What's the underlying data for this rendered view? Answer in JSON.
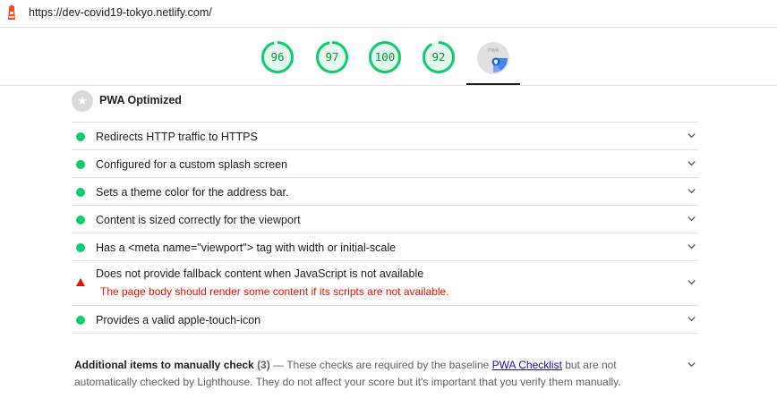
{
  "topbar": {
    "url": "https://dev-covid19-tokyo.netlify.com/",
    "logo_icon": "lighthouse-icon"
  },
  "gauges": [
    {
      "label": "96",
      "value": 96
    },
    {
      "label": "97",
      "value": 97
    },
    {
      "label": "100",
      "value": 100
    },
    {
      "label": "92",
      "value": 92
    }
  ],
  "pwa_gauge": {
    "label": "PWA",
    "icon": "pwa-badge-icon"
  },
  "colors": {
    "pass": "#0cce6b",
    "fail": "#eb0f00",
    "link": "#1a0dab"
  },
  "category": {
    "title": "PWA Optimized",
    "icon": "star-icon"
  },
  "audits": [
    {
      "title": "Redirects HTTP traffic to HTTPS",
      "status": "pass"
    },
    {
      "title": "Configured for a custom splash screen",
      "status": "pass"
    },
    {
      "title": "Sets a theme color for the address bar.",
      "status": "pass"
    },
    {
      "title": "Content is sized correctly for the viewport",
      "status": "pass"
    },
    {
      "title_pre": "Has a ",
      "title_code1": "<meta name=\"viewport\">",
      "title_mid": " tag with ",
      "title_code2": "width",
      "title_mid2": " or ",
      "title_code3": "initial-scale",
      "status": "pass"
    },
    {
      "title": "Does not provide fallback content when JavaScript is not available",
      "description": "The page body should render some content if its scripts are not available.",
      "status": "fail"
    },
    {
      "title_pre": "Provides a valid ",
      "title_code1": "apple-touch-icon",
      "status": "pass"
    }
  ],
  "manual": {
    "title": "Additional items to manually check",
    "count": "(3)",
    "dash": "—",
    "text_pre": "These checks are required by the baseline ",
    "link": "PWA Checklist",
    "text_post": " but are not automatically checked by Lighthouse. They do not affect your score but it's important that you verify them manually."
  }
}
